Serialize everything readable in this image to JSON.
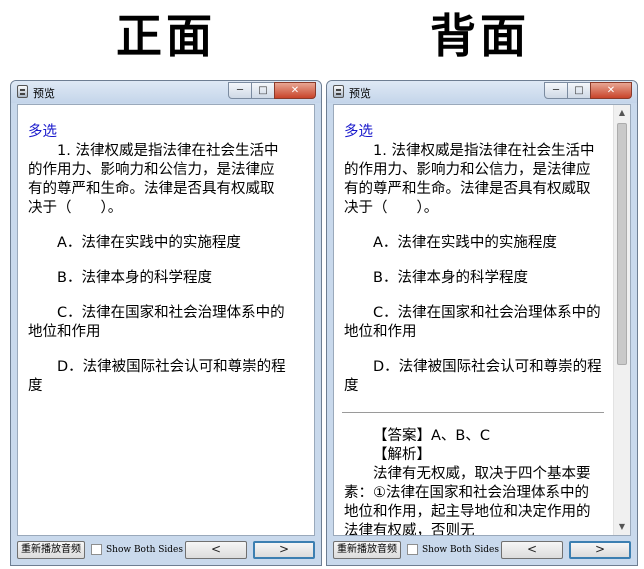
{
  "headings": {
    "front": "正面",
    "back": "背面"
  },
  "window": {
    "title": "预览",
    "minimize_icon": "minimize-icon",
    "maximize_icon": "maximize-icon",
    "close_icon": "close-icon"
  },
  "question": {
    "type": "多选",
    "stem": "1. 法律权威是指法律在社会生活中的作用力、影响力和公信力，是法律应有的尊严和生命。法律是否具有权威取决于（　　）。",
    "options": [
      "A．法律在实践中的实施程度",
      "B．法律本身的科学程度",
      "C．法律在国家和社会治理体系中的地位和作用",
      "D．法律被国际社会认可和尊崇的程度"
    ]
  },
  "answer": {
    "answer_line": "【答案】A、B、C",
    "explanation_title": "【解析】",
    "explanation": "法律有无权威，取决于四个基本要素：①法律在国家和社会治理体系中的地位和作用，起主导地位和决定作用的法律有权威，否则无"
  },
  "bottom": {
    "replay_label": "重新播放音频",
    "show_both_label": "Show Both Sides",
    "prev_label": "<",
    "next_label": ">"
  },
  "colors": {
    "question_type": "#1a1acc",
    "window_frame": "#c9d9ec",
    "close_button": "#c8442b",
    "next_button_border": "#3c7fb1"
  }
}
